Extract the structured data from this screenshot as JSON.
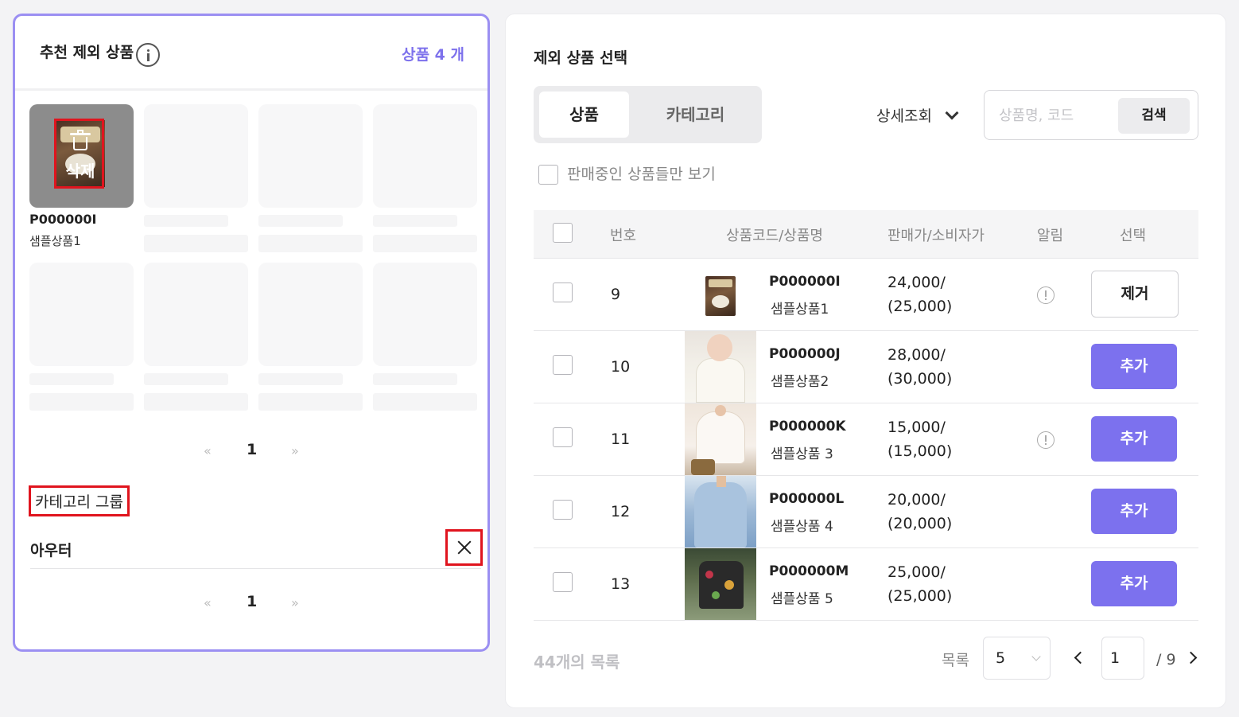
{
  "left_panel": {
    "title": "추천 제외 상품",
    "count_label": "상품 4 개",
    "selected_card": {
      "delete_label": "삭제",
      "code": "P000000I",
      "name": "샘플상품1"
    },
    "pager_top": {
      "prev": "«",
      "page": "1",
      "next": "»"
    },
    "category_group_label": "카테고리 그룹",
    "category_item": "아우터",
    "pager_bottom": {
      "prev": "«",
      "page": "1",
      "next": "»"
    }
  },
  "right_panel": {
    "title": "제외 상품 선택",
    "tabs": [
      {
        "label": "상품",
        "active": true
      },
      {
        "label": "카테고리",
        "active": false
      }
    ],
    "detail_label": "상세조회",
    "search": {
      "placeholder": "상품명, 코드",
      "button": "검색"
    },
    "only_on_sale_label": "판매중인 상품들만 보기",
    "columns": [
      "번호",
      "상품코드/상품명",
      "판매가/소비자가",
      "알림",
      "선택"
    ],
    "rows": [
      {
        "num": "9",
        "code": "P000000I",
        "name": "샘플상품1",
        "price": "24,000/",
        "consumer_price": "(25,000)",
        "alert": true,
        "action": "제거"
      },
      {
        "num": "10",
        "code": "P000000J",
        "name": "샘플상품2",
        "price": "28,000/",
        "consumer_price": "(30,000)",
        "alert": false,
        "action": "추가"
      },
      {
        "num": "11",
        "code": "P000000K",
        "name": "샘플상품 3",
        "price": "15,000/",
        "consumer_price": "(15,000)",
        "alert": true,
        "action": "추가"
      },
      {
        "num": "12",
        "code": "P000000L",
        "name": "샘플상품 4",
        "price": "20,000/",
        "consumer_price": "(20,000)",
        "alert": false,
        "action": "추가"
      },
      {
        "num": "13",
        "code": "P000000M",
        "name": "샘플상품 5",
        "price": "25,000/",
        "consumer_price": "(25,000)",
        "alert": false,
        "action": "추가"
      }
    ],
    "footer": {
      "total_label": "44개의 목록",
      "per_page_label": "목록",
      "per_page_value": "5",
      "current_page": "1",
      "total_pages": "/ 9"
    },
    "colors": {
      "accent": "#7c71ee",
      "panel_border": "#9b8ff2",
      "highlight": "#e0141e"
    }
  }
}
